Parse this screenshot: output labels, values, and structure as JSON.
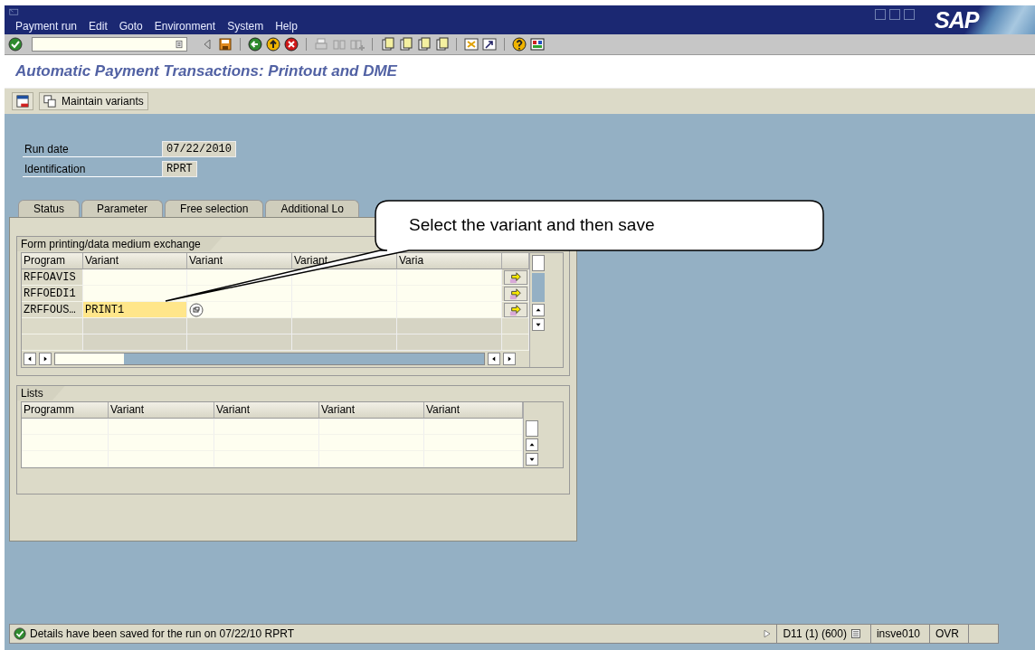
{
  "window": {
    "menu": [
      "Payment run",
      "Edit",
      "Goto",
      "Environment",
      "System",
      "Help"
    ],
    "logo": "SAP"
  },
  "title": "Automatic Payment Transactions: Printout and DME",
  "app_toolbar": {
    "buttons": [
      "Maintain variants"
    ]
  },
  "fields": [
    {
      "label": "Run date",
      "value": "07/22/2010"
    },
    {
      "label": "Identification",
      "value": "RPRT"
    }
  ],
  "tabs": [
    {
      "label": "Status",
      "selected": false
    },
    {
      "label": "Parameter",
      "selected": false
    },
    {
      "label": "Free selection",
      "selected": false
    },
    {
      "label": "Additional Lo",
      "selected": false
    }
  ],
  "form_table": {
    "title": "Form printing/data medium exchange",
    "columns": [
      "Program",
      "Variant",
      "Variant",
      "Variant",
      "Varia"
    ],
    "rows": [
      {
        "program": "RFFOAVIS",
        "selected": false
      },
      {
        "program": "RFFOEDI1",
        "selected": false
      },
      {
        "program": "ZRFFOUS…",
        "variant": "PRINT1",
        "selected": true
      }
    ]
  },
  "lists_table": {
    "title": "Lists",
    "columns": [
      "Programm",
      "Variant",
      "Variant",
      "Variant",
      "Variant"
    ]
  },
  "callout": {
    "text": "Select the variant and then save"
  },
  "status_bar": {
    "message": "Details have been saved for the run on 07/22/10 RPRT",
    "system": "D11 (1) (600)",
    "server": "insve010",
    "mode": "OVR"
  }
}
